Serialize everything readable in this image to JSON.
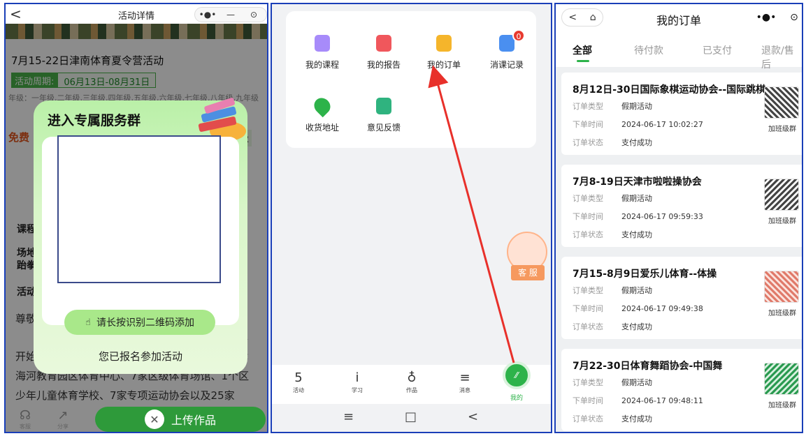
{
  "panel1": {
    "back": "<",
    "title": "活动详情",
    "capsule": [
      "•●•",
      "—",
      "⊙"
    ],
    "headline": "7月15-22日津南体育夏令营活动",
    "period_label": "活动周期:",
    "period_value": "06月13日-08月31日",
    "grade_text": "年级：一年级,二年级,三年级,四年级,五年级,六年级,七年级,八年级,九年级",
    "free_text": "免费",
    "level_text": "级",
    "side_labels": [
      "课程",
      "场地",
      "跆拳",
      "活动"
    ],
    "para_lines": [
      "尊敬",
      "开始",
      "海河教育园区体育中心、7家区级体育场馆、1个区",
      "少年儿童体育学校、7家专项运动协会以及25家"
    ],
    "para_right": [
      "要",
      "津"
    ],
    "modal_title": "进入专属服务群",
    "hint": "请长按识别二维码添加",
    "joined": "您已报名参加活动",
    "upload": "上传作品",
    "bottom_icons": [
      {
        "label": "客服"
      },
      {
        "label": "分享"
      }
    ]
  },
  "panel2": {
    "grid": [
      {
        "label": "我的课程",
        "color": "#a78bfa"
      },
      {
        "label": "我的报告",
        "color": "#f0575c"
      },
      {
        "label": "我的订单",
        "color": "#f5b52b"
      },
      {
        "label": "消课记录",
        "color": "#4a8ff0",
        "badge": "0"
      },
      {
        "label": "收货地址",
        "color": "#2db34a"
      },
      {
        "label": "意见反馈",
        "color": "#2fb37f"
      }
    ],
    "service_label": "客 服",
    "tabs": [
      {
        "label": "活动",
        "glyph": "5"
      },
      {
        "label": "学习",
        "glyph": "i"
      },
      {
        "label": "作品",
        "glyph": "♁"
      },
      {
        "label": "消息",
        "glyph": "≡"
      }
    ],
    "mine_label": "我的",
    "mine_glyph": "⁄⁄",
    "nav": [
      "≡",
      "□",
      "<"
    ]
  },
  "panel3": {
    "back_glyphs": [
      "<",
      "⌂"
    ],
    "title": "我的订单",
    "capsule": [
      "•●•",
      "⊙"
    ],
    "tabs": [
      "全部",
      "待付款",
      "已支付",
      "退款/售后"
    ],
    "active_tab": "全部",
    "orders": [
      {
        "title": "8月12日-30日国际象棋运动协会--国际跳棋",
        "type": "假期活动",
        "time": "2024-06-17 10:02:27",
        "status": "支付成功",
        "qr_label": "加班级群",
        "qr_color": "#444444"
      },
      {
        "title": "7月8-19日天津市啦啦操协会",
        "type": "假期活动",
        "time": "2024-06-17 09:59:33",
        "status": "支付成功",
        "qr_label": "加班级群",
        "qr_color": "#444444"
      },
      {
        "title": "7月15-8月9日爱乐儿体育--体操",
        "type": "假期活动",
        "time": "2024-06-17 09:49:38",
        "status": "支付成功",
        "qr_label": "加班级群",
        "qr_color": "#e07a6a"
      },
      {
        "title": "7月22-30日体育舞蹈协会-中国舞",
        "type": "假期活动",
        "time": "2024-06-17 09:48:11",
        "status": "支付成功",
        "qr_label": "加班级群",
        "qr_color": "#2a9a50"
      }
    ],
    "row_keys": {
      "type": "订单类型",
      "time": "下单时间",
      "status": "订单状态"
    }
  },
  "colors": {
    "accent_green": "#2db34a",
    "arrow_red": "#e8302a",
    "panel_border": "#1a3fb8"
  }
}
